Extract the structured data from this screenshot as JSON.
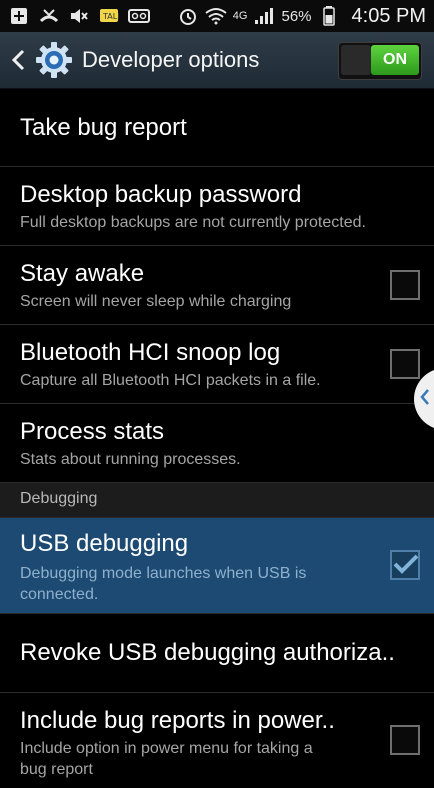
{
  "status_bar": {
    "battery_percent": "56%",
    "time": "4:05 PM",
    "network": "4G",
    "icons": [
      "add-icon",
      "missed-call-icon",
      "voicemail-icon",
      "talk-icon",
      "mute-icon",
      "alarm-icon",
      "wifi-icon",
      "signal-icon",
      "battery-icon"
    ]
  },
  "header": {
    "title": "Developer options",
    "toggle_label": "ON"
  },
  "items": [
    {
      "label": "Take bug report"
    },
    {
      "label": "Desktop backup password",
      "sub": "Full desktop backups are not currently protected."
    },
    {
      "label": "Stay awake",
      "sub": "Screen will never sleep while charging"
    },
    {
      "label": "Bluetooth HCI snoop log",
      "sub": "Capture all Bluetooth HCI packets in a file."
    },
    {
      "label": "Process stats",
      "sub": "Stats about running processes."
    }
  ],
  "section": {
    "debugging": "Debugging"
  },
  "debug_items": [
    {
      "label": "USB debugging",
      "sub_line1": "Debugging mode launches when USB is",
      "sub_line2": "connected."
    },
    {
      "label": "Revoke USB debugging authoriza.."
    },
    {
      "label": "Include bug reports in power..",
      "sub_line1": "Include option in power menu for taking a",
      "sub_line2": "bug report"
    }
  ],
  "colors": {
    "highlight": "#1d4a73",
    "toggle_green": "#3cb52a",
    "actionbar": "#263440"
  }
}
